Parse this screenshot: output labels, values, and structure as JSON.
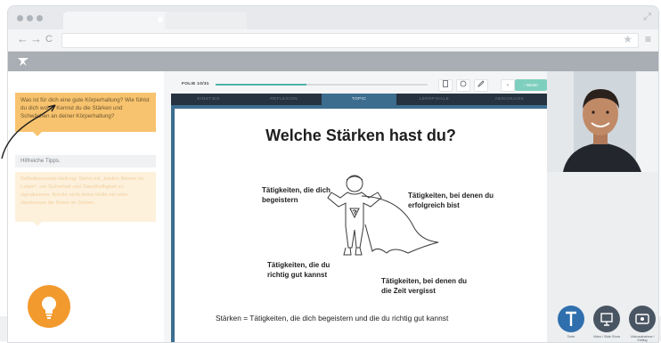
{
  "browser": {
    "icons": [
      "back-arrow-icon",
      "forward-arrow-icon",
      "reload-icon",
      "bookmark-star-icon",
      "menu-icon",
      "expand-icon"
    ],
    "back": "←",
    "forward": "→",
    "reload": "C",
    "star": "★",
    "menu": "≡",
    "expand": "⤢"
  },
  "progress": {
    "label": "FOLIE 10/31",
    "fraction": 0.43
  },
  "toolbar": {
    "prev": "‹",
    "next": "› Weiter"
  },
  "section_tabs": [
    {
      "label": "EINSTIEG",
      "active": false
    },
    {
      "label": "REFLEXION",
      "active": false
    },
    {
      "label": "TOPIC",
      "active": true
    },
    {
      "label": "LERNFINALE",
      "active": false
    },
    {
      "label": "ABSCHLUSS",
      "active": false
    }
  ],
  "left": {
    "question": "Was ist für dich eine gute Körperhaltung? Wie fühlst du dich wohl? Kennst du die Stärken und Schwächen an deiner Körperhaltung?",
    "tips_title": "Hilfreiche Tipps.",
    "tips_text": "Selbstbewusste Haltung: Stehe mit „beiden Beinen im Leben“, um Sicherheit und Standhaftigkeit zu signalisieren. Knicke nicht deine Hüfte ein oder überkreuze die Beine im Stehen."
  },
  "slide": {
    "title": "Welche Stärken hast du?",
    "label_top_left": "Tätigkeiten, die dich begeistern",
    "label_top_right": "Tätigkeiten, bei denen du erfolgreich bist",
    "label_bottom_left": "Tätigkeiten, die du richtig gut kannst",
    "label_bottom_right": "Tätigkeiten, bei denen du die Zeit vergisst",
    "formula": "Stärken = Tätigkeiten, die dich begeistern und die du richtig gut kannst"
  },
  "controls": [
    {
      "label": "Texte",
      "icon": "text-t-icon",
      "color": "#2f6fae"
    },
    {
      "label": "Video / Slide Show",
      "icon": "presentation-icon",
      "color": "#4a5563"
    },
    {
      "label": "Videoaufnahme / Editing",
      "icon": "video-screen-icon",
      "color": "#4a5563"
    }
  ],
  "colors": {
    "accent": "#f29a2e",
    "teal": "#4fb3a8",
    "slide_frame": "#3c6d8f",
    "tabbar": "#26323f"
  }
}
